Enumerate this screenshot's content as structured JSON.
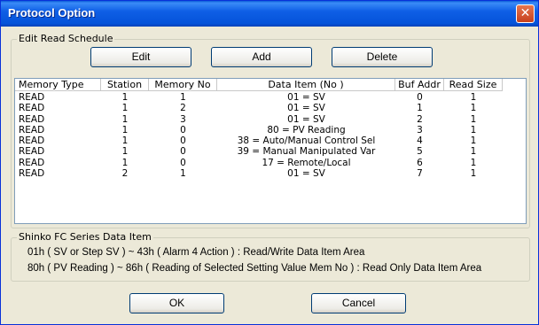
{
  "window": {
    "title": "Protocol Option",
    "close_glyph": "✕"
  },
  "schedule_group": {
    "label": "Edit Read Schedule",
    "edit_label": "Edit",
    "add_label": "Add",
    "delete_label": "Delete"
  },
  "table": {
    "columns": [
      "Memory Type",
      "Station",
      "Memory No",
      "Data Item (No )",
      "Buf Addr",
      "Read Size"
    ],
    "rows": [
      [
        "READ",
        "1",
        "1",
        "01 = SV",
        "0",
        "1"
      ],
      [
        "READ",
        "1",
        "2",
        "01 = SV",
        "1",
        "1"
      ],
      [
        "READ",
        "1",
        "3",
        "01 = SV",
        "2",
        "1"
      ],
      [
        "READ",
        "1",
        "0",
        "80 = PV Reading",
        "3",
        "1"
      ],
      [
        "READ",
        "1",
        "0",
        "38 = Auto/Manual Control Sel",
        "4",
        "1"
      ],
      [
        "READ",
        "1",
        "0",
        "39 = Manual Manipulated Var",
        "5",
        "1"
      ],
      [
        "READ",
        "1",
        "0",
        "17 = Remote/Local",
        "6",
        "1"
      ],
      [
        "READ",
        "2",
        "1",
        "01 = SV",
        "7",
        "1"
      ]
    ]
  },
  "info_group": {
    "label": "Shinko FC Series Data Item",
    "line1": "01h ( SV or Step SV ) ~ 43h ( Alarm 4 Action ) : Read/Write Data Item Area",
    "line2": "80h ( PV Reading ) ~ 86h ( Reading of Selected Setting Value Mem No ) : Read Only Data Item Area"
  },
  "footer": {
    "ok_label": "OK",
    "cancel_label": "Cancel"
  }
}
